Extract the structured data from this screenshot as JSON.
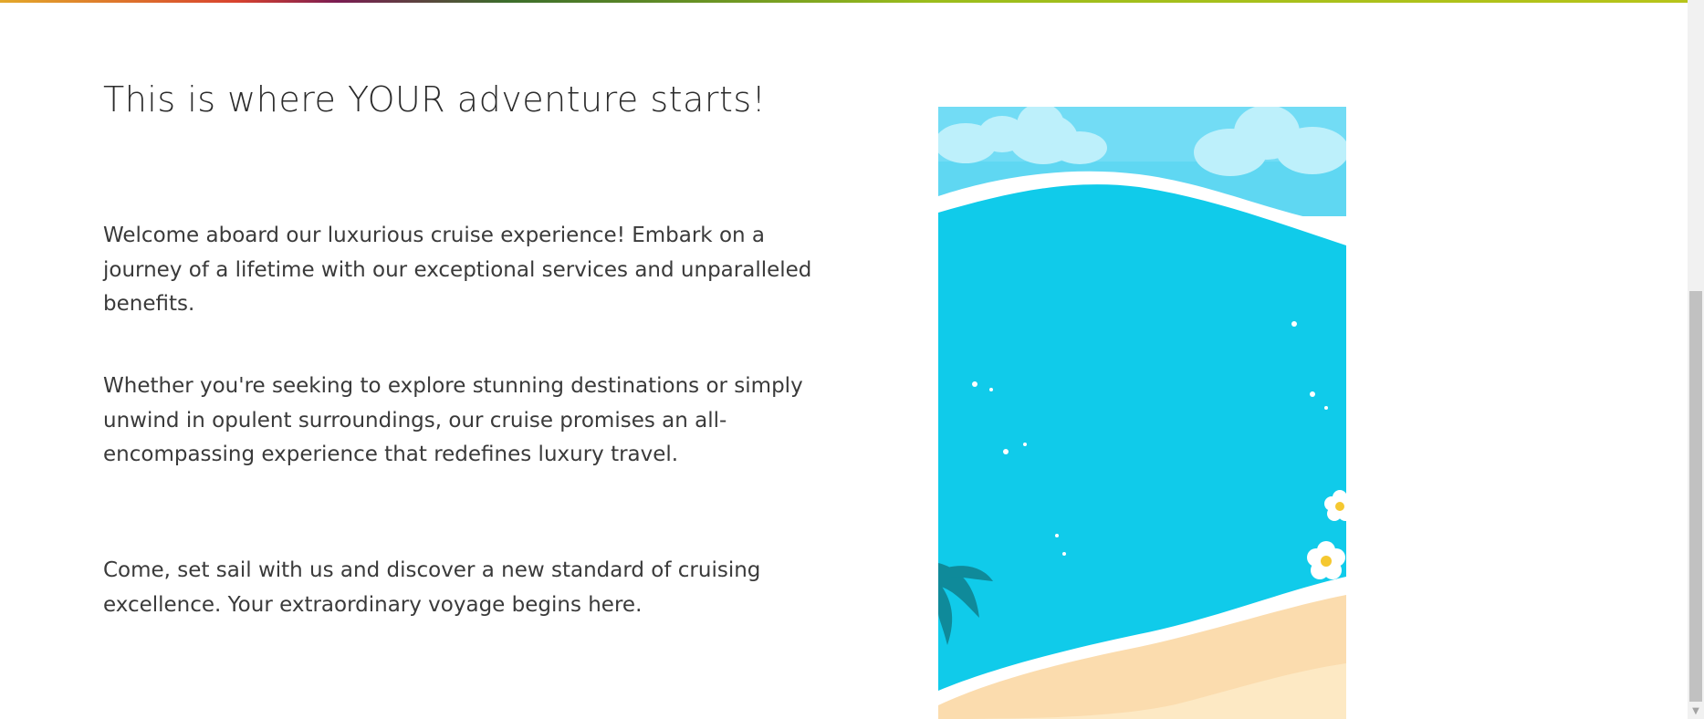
{
  "section": {
    "heading": "This is where YOUR adventure starts!",
    "paragraphs": [
      "Welcome aboard our luxurious cruise experience! Embark on a journey of a lifetime with our exceptional services and unparalleled benefits.",
      "Whether you're seeking to explore stunning destinations or simply unwind in opulent surroundings, our cruise promises an all-encompassing experience that redefines luxury travel.",
      "Come, set sail with us and discover a new standard of cruising excellence. Your extraordinary voyage begins here."
    ]
  },
  "image": {
    "subject": "beach-ocean-illustration"
  },
  "colors": {
    "ocean": "#10cbea",
    "sky": "#5fd7f2",
    "sand": "#fbdcae",
    "foam": "#ffffff",
    "text": "#3a3a3a"
  },
  "scrollbar": {
    "arrow_icon": "chevron-down-icon"
  }
}
